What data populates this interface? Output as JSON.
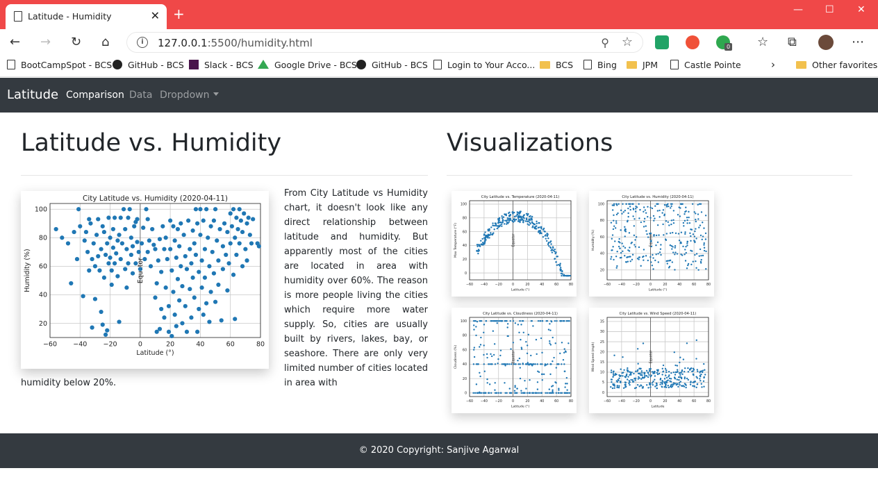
{
  "browser": {
    "tab_title": "Latitude - Humidity",
    "close_glyph": "✕",
    "new_tab_glyph": "+",
    "url_host": "127.0.0.1",
    "url_path": ":5500/humidity.html",
    "favorites": [
      {
        "label": "BootCampSpot - BCS",
        "icon": "page-icon"
      },
      {
        "label": "GitHub - BCS",
        "icon": "github-icon"
      },
      {
        "label": "Slack - BCS",
        "icon": "slack-icon"
      },
      {
        "label": "Google Drive - BCS",
        "icon": "google-drive-icon"
      },
      {
        "label": "GitHub - BCS",
        "icon": "github-icon"
      },
      {
        "label": "Login to Your Acco...",
        "icon": "page-icon"
      },
      {
        "label": "BCS",
        "icon": "folder-icon"
      },
      {
        "label": "Bing",
        "icon": "page-icon"
      },
      {
        "label": "JPM",
        "icon": "folder-icon"
      },
      {
        "label": "Castle Pointe",
        "icon": "page-icon"
      }
    ],
    "other_favorites": "Other favorites",
    "extension_badge": "0"
  },
  "navbar": {
    "brand": "Latitude",
    "links": [
      "Comparison",
      "Data",
      "Dropdown"
    ]
  },
  "left": {
    "heading": "Latitude vs. Humidity",
    "paragraph_right": "From City Latitude vs Humidity chart, it doesn't look like any direct relationship between latitude and humidity. But apparently most of the cities are located in area with humidity over 60%. The reason is more people living the cities which require more water supply. So, cities are usually built by rivers, lakes, bay, or seashore. There are only very limited number of cities located in area with",
    "paragraph_tail": "humidity below 20%."
  },
  "right": {
    "heading": "Visualizations"
  },
  "footer": {
    "text": "© 2020 Copyright: Sanjive Agarwal"
  },
  "colors": {
    "titlebar": "#f04848",
    "navbar": "#343a40",
    "point": "#1f77b4"
  },
  "chart_data": [
    {
      "type": "scatter",
      "title": "City Latitude vs. Humidity (2020-04-11)",
      "xlabel": "Latitude (°)",
      "ylabel": "Humidity (%)",
      "xlim": [
        -60,
        80
      ],
      "ylim": [
        10,
        104
      ],
      "xticks": [
        -60,
        -40,
        -20,
        0,
        20,
        40,
        60,
        80
      ],
      "yticks": [
        20,
        40,
        60,
        80,
        100
      ],
      "annotation": "Equator",
      "grid": true,
      "points": [
        [
          -56,
          86
        ],
        [
          -52,
          80
        ],
        [
          -48,
          76
        ],
        [
          -46,
          48
        ],
        [
          -44,
          84
        ],
        [
          -42,
          65
        ],
        [
          -41,
          100
        ],
        [
          -40,
          88
        ],
        [
          -38,
          39
        ],
        [
          -37,
          78
        ],
        [
          -36,
          84
        ],
        [
          -35,
          70
        ],
        [
          -34,
          57
        ],
        [
          -34,
          93
        ],
        [
          -33,
          90
        ],
        [
          -32,
          65
        ],
        [
          -32,
          17
        ],
        [
          -31,
          76
        ],
        [
          -30,
          60
        ],
        [
          -30,
          37
        ],
        [
          -29,
          82
        ],
        [
          -28,
          67
        ],
        [
          -28,
          93
        ],
        [
          -27,
          57
        ],
        [
          -26,
          72
        ],
        [
          -26,
          28
        ],
        [
          -25,
          19
        ],
        [
          -25,
          88
        ],
        [
          -24,
          84
        ],
        [
          -24,
          52
        ],
        [
          -23,
          68
        ],
        [
          -23,
          12
        ],
        [
          -22,
          76
        ],
        [
          -22,
          15
        ],
        [
          -21,
          62
        ],
        [
          -21,
          94
        ],
        [
          -20,
          80
        ],
        [
          -20,
          66
        ],
        [
          -19,
          57
        ],
        [
          -19,
          47
        ],
        [
          -18,
          73
        ],
        [
          -18,
          86
        ],
        [
          -17,
          62
        ],
        [
          -17,
          94
        ],
        [
          -16,
          69
        ],
        [
          -15,
          78
        ],
        [
          -15,
          53
        ],
        [
          -14,
          82
        ],
        [
          -14,
          21
        ],
        [
          -13,
          65
        ],
        [
          -13,
          94
        ],
        [
          -12,
          76
        ],
        [
          -11,
          100
        ],
        [
          -10,
          58
        ],
        [
          -10,
          86
        ],
        [
          -9,
          72
        ],
        [
          -9,
          45
        ],
        [
          -8,
          62
        ],
        [
          -8,
          94
        ],
        [
          -7,
          100
        ],
        [
          -6,
          80
        ],
        [
          -6,
          68
        ],
        [
          -5,
          74
        ],
        [
          -5,
          55
        ],
        [
          -4,
          88
        ],
        [
          -3,
          91
        ],
        [
          -3,
          62
        ],
        [
          -2,
          77
        ],
        [
          -2,
          93
        ],
        [
          -1,
          70
        ],
        [
          0,
          58
        ],
        [
          1,
          76
        ],
        [
          2,
          87
        ],
        [
          3,
          65
        ],
        [
          4,
          100
        ],
        [
          5,
          93
        ],
        [
          5,
          70
        ],
        [
          6,
          78
        ],
        [
          7,
          60
        ],
        [
          8,
          86
        ],
        [
          9,
          75
        ],
        [
          10,
          72
        ],
        [
          10,
          38
        ],
        [
          11,
          48
        ],
        [
          11,
          14
        ],
        [
          12,
          64
        ],
        [
          13,
          79
        ],
        [
          13,
          16
        ],
        [
          14,
          56
        ],
        [
          14,
          30
        ],
        [
          15,
          88
        ],
        [
          16,
          72
        ],
        [
          16,
          24
        ],
        [
          17,
          45
        ],
        [
          17,
          80
        ],
        [
          18,
          65
        ],
        [
          19,
          14
        ],
        [
          19,
          32
        ],
        [
          20,
          92
        ],
        [
          20,
          72
        ],
        [
          21,
          57
        ],
        [
          21,
          11
        ],
        [
          22,
          42
        ],
        [
          22,
          88
        ],
        [
          23,
          78
        ],
        [
          23,
          26
        ],
        [
          24,
          66
        ],
        [
          24,
          18
        ],
        [
          25,
          51
        ],
        [
          25,
          86
        ],
        [
          26,
          74
        ],
        [
          26,
          36
        ],
        [
          27,
          90
        ],
        [
          27,
          60
        ],
        [
          28,
          46
        ],
        [
          28,
          20
        ],
        [
          29,
          82
        ],
        [
          30,
          67
        ],
        [
          30,
          32
        ],
        [
          31,
          58
        ],
        [
          31,
          14
        ],
        [
          32,
          92
        ],
        [
          33,
          72
        ],
        [
          33,
          44
        ],
        [
          34,
          62
        ],
        [
          34,
          24
        ],
        [
          35,
          85
        ],
        [
          35,
          52
        ],
        [
          36,
          76
        ],
        [
          36,
          38
        ],
        [
          37,
          100
        ],
        [
          37,
          68
        ],
        [
          38,
          90
        ],
        [
          38,
          14
        ],
        [
          39,
          56
        ],
        [
          39,
          30
        ],
        [
          40,
          100
        ],
        [
          40,
          82
        ],
        [
          41,
          64
        ],
        [
          41,
          45
        ],
        [
          42,
          92
        ],
        [
          42,
          26
        ],
        [
          43,
          72
        ],
        [
          43,
          52
        ],
        [
          44,
          100
        ],
        [
          44,
          34
        ],
        [
          45,
          80
        ],
        [
          46,
          60
        ],
        [
          46,
          21
        ],
        [
          47,
          88
        ],
        [
          47,
          42
        ],
        [
          48,
          70
        ],
        [
          49,
          92
        ],
        [
          49,
          55
        ],
        [
          50,
          100
        ],
        [
          50,
          35
        ],
        [
          51,
          78
        ],
        [
          52,
          64
        ],
        [
          52,
          47
        ],
        [
          53,
          86
        ],
        [
          54,
          22
        ],
        [
          55,
          74
        ],
        [
          55,
          58
        ],
        [
          56,
          90
        ],
        [
          57,
          68
        ],
        [
          58,
          43
        ],
        [
          58,
          84
        ],
        [
          59,
          62
        ],
        [
          60,
          97
        ],
        [
          60,
          76
        ],
        [
          61,
          88
        ],
        [
          62,
          100
        ],
        [
          62,
          54
        ],
        [
          63,
          80
        ],
        [
          63,
          23
        ],
        [
          64,
          94
        ],
        [
          64,
          68
        ],
        [
          65,
          86
        ],
        [
          66,
          100
        ],
        [
          66,
          76
        ],
        [
          67,
          92
        ],
        [
          68,
          60
        ],
        [
          68,
          84
        ],
        [
          69,
          97
        ],
        [
          70,
          72
        ],
        [
          71,
          90
        ],
        [
          71,
          64
        ],
        [
          72,
          94
        ],
        [
          73,
          82
        ],
        [
          74,
          76
        ],
        [
          75,
          93
        ],
        [
          78,
          76
        ],
        [
          79,
          74
        ]
      ]
    },
    {
      "type": "scatter",
      "title": "City Latitude vs. Temperature (2020-04-11)",
      "xlabel": "Latitude (°)",
      "ylabel": "Max Temperature (°F)",
      "xlim": [
        -60,
        80
      ],
      "ylim": [
        -10,
        105
      ],
      "xticks": [
        -60,
        -40,
        -20,
        0,
        20,
        40,
        60,
        80
      ],
      "yticks": [
        0,
        20,
        40,
        60,
        80,
        100
      ],
      "annotation": "Equator"
    },
    {
      "type": "scatter",
      "title": "City Latitude vs. Humidity (2020-04-11)",
      "xlabel": "Latitude (°)",
      "ylabel": "Humidity (%)",
      "xlim": [
        -60,
        80
      ],
      "ylim": [
        8,
        104
      ],
      "xticks": [
        -60,
        -40,
        -20,
        0,
        20,
        40,
        60,
        80
      ],
      "yticks": [
        20,
        40,
        60,
        80,
        100
      ],
      "annotation": "Equator"
    },
    {
      "type": "scatter",
      "title": "City Latitude vs. Cloudiness (2020-04-11)",
      "xlabel": "Latitude (°)",
      "ylabel": "Cloudiness (%)",
      "xlim": [
        -60,
        80
      ],
      "ylim": [
        -5,
        105
      ],
      "xticks": [
        -60,
        -40,
        -20,
        0,
        20,
        40,
        60,
        80
      ],
      "yticks": [
        0,
        20,
        40,
        60,
        80,
        100
      ],
      "annotation": "Equator"
    },
    {
      "type": "scatter",
      "title": "City Latitude vs. Wind Speed (2020-04-11)",
      "xlabel": "Latitude",
      "ylabel": "Wind Speed (mph)",
      "xlim": [
        -60,
        80
      ],
      "ylim": [
        -2,
        37
      ],
      "xticks": [
        -60,
        -40,
        -20,
        0,
        20,
        40,
        60,
        80
      ],
      "yticks": [
        0,
        5,
        10,
        15,
        20,
        25,
        30,
        35
      ],
      "annotation": "Equator"
    }
  ]
}
